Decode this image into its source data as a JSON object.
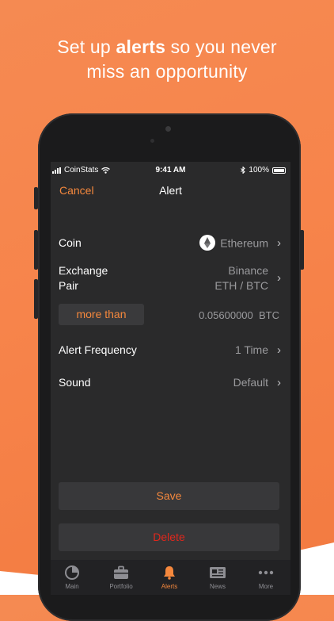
{
  "headline": {
    "pre": "Set up ",
    "bold": "alerts",
    "post": " so you never",
    "line2": "miss an opportunity"
  },
  "status_bar": {
    "carrier": "CoinStats",
    "time": "9:41 AM",
    "battery": "100%"
  },
  "nav": {
    "cancel": "Cancel",
    "title": "Alert"
  },
  "form": {
    "coin_label": "Coin",
    "coin_value": "Ethereum",
    "coin_icon": "ethereum-icon",
    "exchange_label": "Exchange",
    "pair_label": "Pair",
    "exchange_value": "Binance",
    "pair_value": "ETH / BTC",
    "condition": "more than",
    "amount": "0.05600000",
    "amount_unit": "BTC",
    "frequency_label": "Alert Frequency",
    "frequency_value": "1 Time",
    "sound_label": "Sound",
    "sound_value": "Default"
  },
  "actions": {
    "save": "Save",
    "delete": "Delete"
  },
  "tabs": [
    {
      "label": "Main",
      "icon": "pie-chart-icon"
    },
    {
      "label": "Portfolio",
      "icon": "briefcase-icon"
    },
    {
      "label": "Alerts",
      "icon": "bell-icon"
    },
    {
      "label": "News",
      "icon": "newspaper-icon"
    },
    {
      "label": "More",
      "icon": "more-dots-icon"
    }
  ],
  "colors": {
    "accent": "#f5883d",
    "delete": "#e0271c",
    "background": "#2a2a2b",
    "promo_background": "#f58a52"
  }
}
